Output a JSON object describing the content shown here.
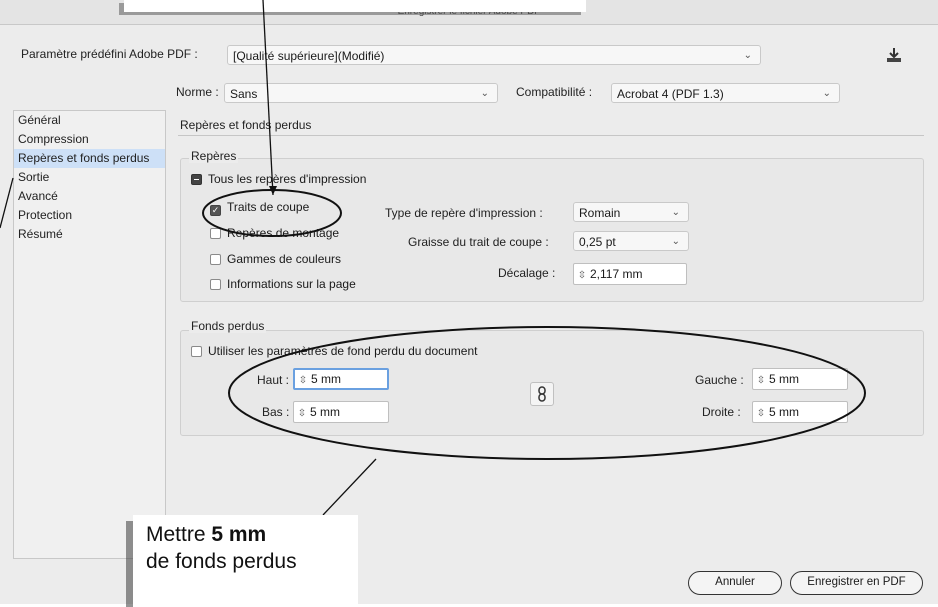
{
  "window": {
    "title": "Enregistrer le fichier Adobe PDF"
  },
  "preset": {
    "label": "Paramètre prédéfini Adobe PDF :",
    "value": "[Qualité supérieure](Modifié)"
  },
  "standard": {
    "label": "Norme :",
    "value": "Sans"
  },
  "compat": {
    "label": "Compatibilité :",
    "value": "Acrobat 4 (PDF 1.3)"
  },
  "sidebar": {
    "items": [
      {
        "label": "Général"
      },
      {
        "label": "Compression"
      },
      {
        "label": "Repères et fonds perdus"
      },
      {
        "label": "Sortie"
      },
      {
        "label": "Avancé"
      },
      {
        "label": "Protection"
      },
      {
        "label": "Résumé"
      }
    ]
  },
  "panel": {
    "title": "Repères et fonds perdus"
  },
  "marks": {
    "group_title": "Repères",
    "all_marks": "Tous les repères d'impression",
    "trim": "Traits de coupe",
    "registration": "Repères de montage",
    "color_bars": "Gammes de couleurs",
    "page_info": "Informations sur la page",
    "type_label": "Type de repère d'impression :",
    "type_value": "Romain",
    "weight_label": "Graisse du trait de coupe :",
    "weight_value": "0,25 pt",
    "offset_label": "Décalage :",
    "offset_value": "2,117 mm"
  },
  "bleeds": {
    "group_title": "Fonds perdus",
    "use_doc": "Utiliser les paramètres de fond perdu du document",
    "top_label": "Haut :",
    "top_value": "5 mm",
    "bottom_label": "Bas :",
    "bottom_value": "5 mm",
    "left_label": "Gauche :",
    "left_value": "5 mm",
    "right_label": "Droite :",
    "right_value": "5 mm"
  },
  "buttons": {
    "cancel": "Annuler",
    "save": "Enregistrer en PDF"
  },
  "callout": {
    "line1_prefix": "Mettre",
    "line1_bold": "5 mm",
    "line2": "de fonds perdus"
  },
  "icons": {
    "save_preset": "download-preset-icon",
    "chain": "chain-link-icon",
    "spinner": "stepper-icon",
    "dropdown": "chevron-down-icon"
  }
}
